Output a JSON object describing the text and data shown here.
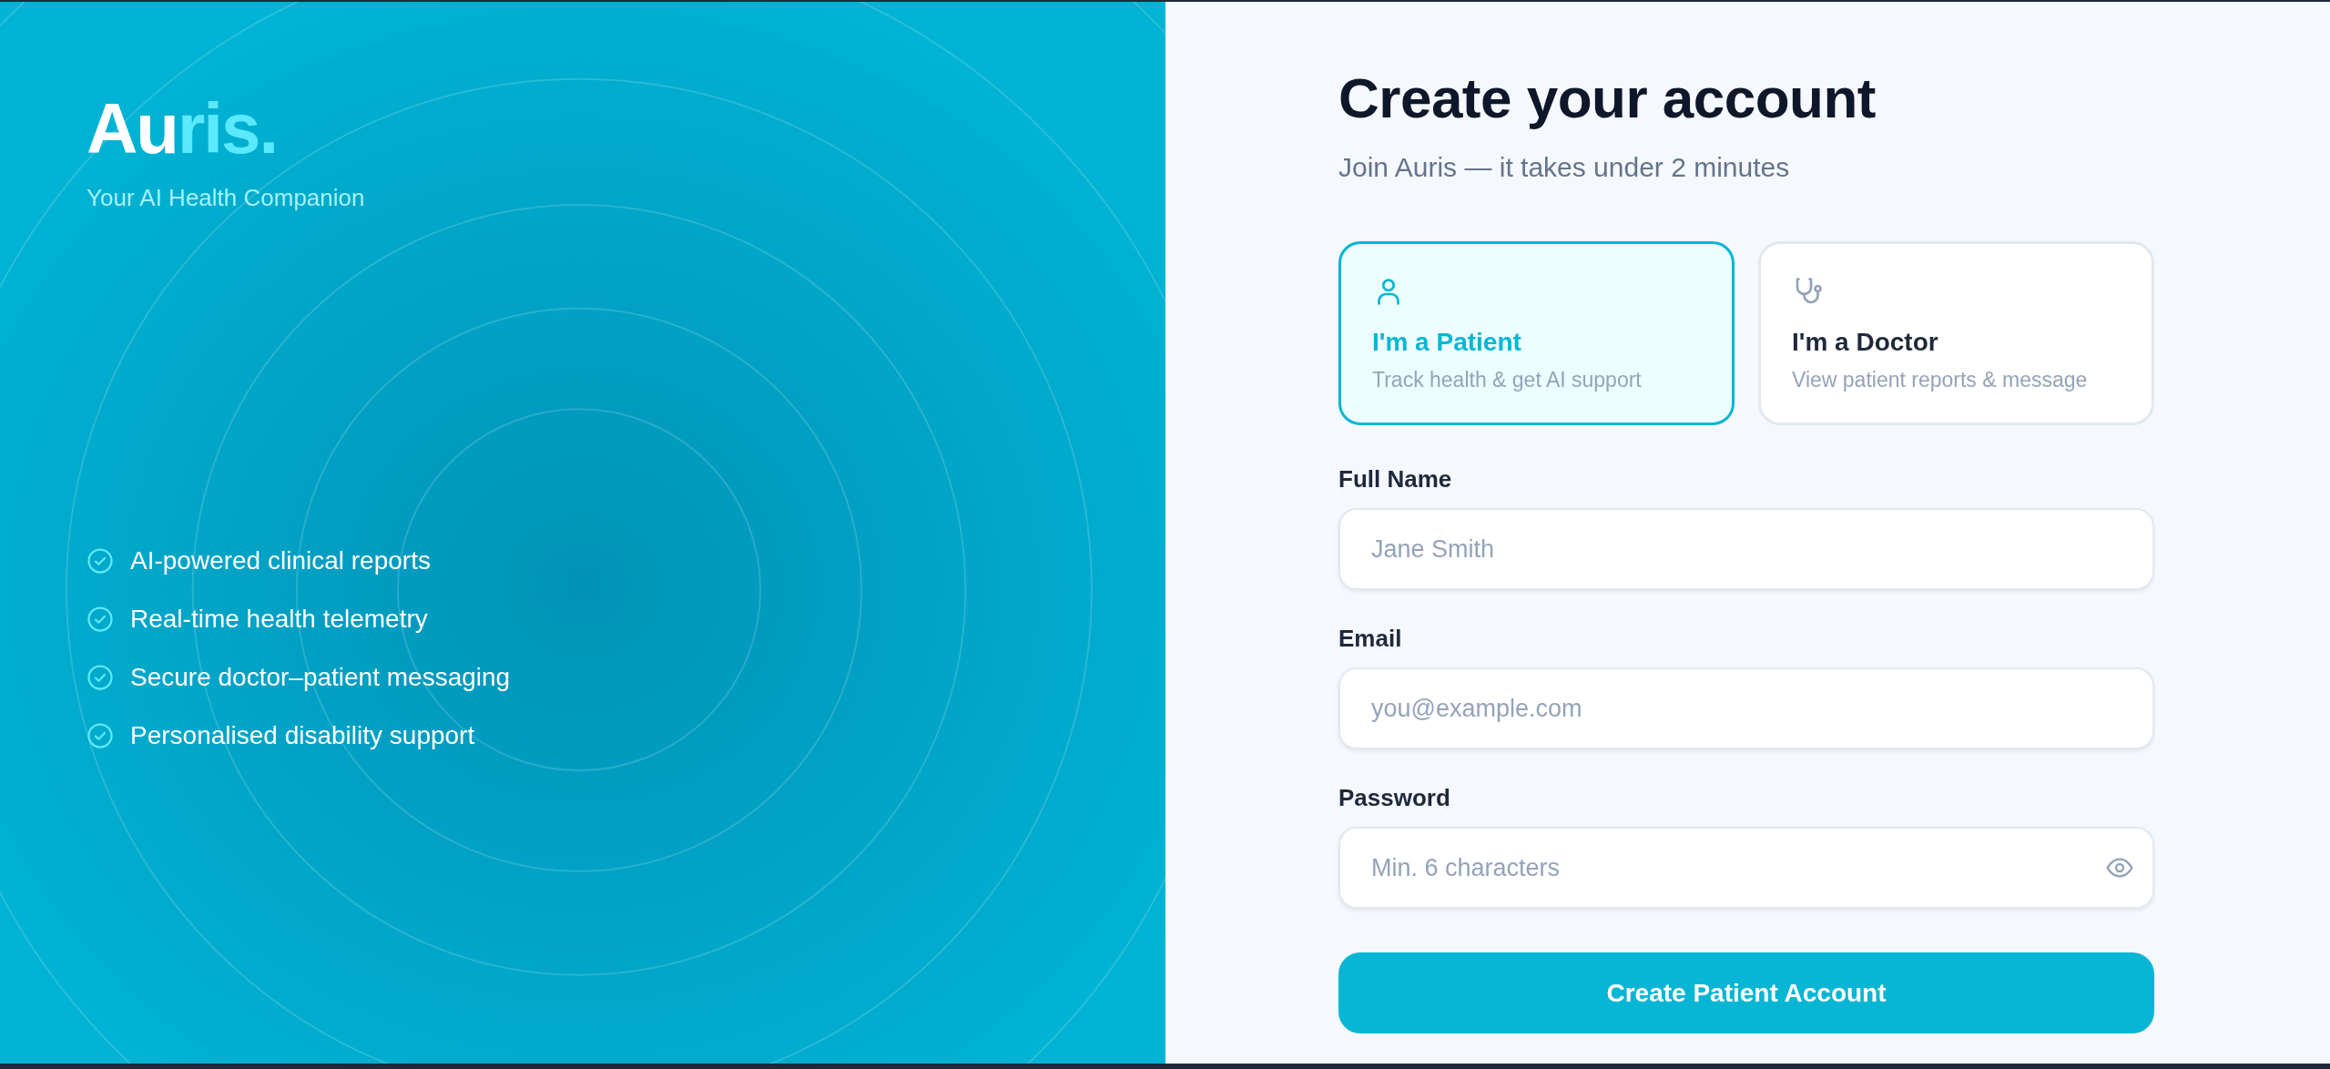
{
  "brand": {
    "logo_start": "Au",
    "logo_end": "ris.",
    "tagline": "Your AI Health Companion"
  },
  "features": [
    {
      "label": "AI-powered clinical reports"
    },
    {
      "label": "Real-time health telemetry"
    },
    {
      "label": "Secure doctor–patient messaging"
    },
    {
      "label": "Personalised disability support"
    }
  ],
  "form": {
    "title": "Create your account",
    "subtitle": "Join Auris — it takes under 2 minutes",
    "roles": [
      {
        "kind": "patient",
        "title": "I'm a Patient",
        "description": "Track health & get AI support",
        "selected": true
      },
      {
        "kind": "doctor",
        "title": "I'm a Doctor",
        "description": "View patient reports & message",
        "selected": false
      }
    ],
    "fields": [
      {
        "kind": "text",
        "label": "Full Name",
        "placeholder": "Jane Smith"
      },
      {
        "kind": "email",
        "label": "Email",
        "placeholder": "you@example.com"
      },
      {
        "kind": "password",
        "label": "Password",
        "placeholder": "Min. 6 characters"
      }
    ],
    "submit": "Create Patient Account"
  }
}
